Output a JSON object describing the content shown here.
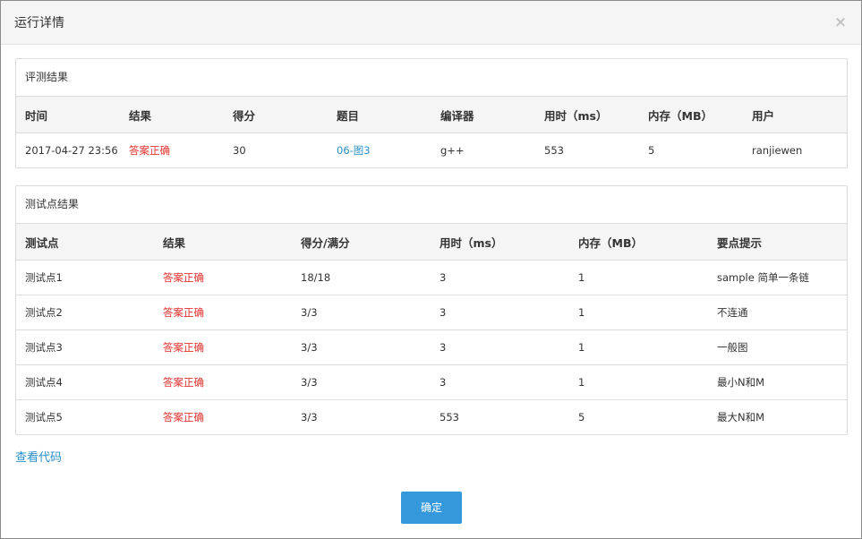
{
  "dialog": {
    "title": "运行详情",
    "close_glyph": "×"
  },
  "judge": {
    "heading": "评测结果",
    "columns": [
      "时间",
      "结果",
      "得分",
      "题目",
      "编译器",
      "用时（ms）",
      "内存（MB）",
      "用户"
    ],
    "row": {
      "time": "2017-04-27 23:56",
      "result": "答案正确",
      "score": "30",
      "problem": "06-图3",
      "compiler": "g++",
      "time_ms": "553",
      "memory_mb": "5",
      "user": "ranjiewen"
    }
  },
  "tests": {
    "heading": "测试点结果",
    "columns": [
      "测试点",
      "结果",
      "得分/满分",
      "用时（ms）",
      "内存（MB）",
      "要点提示"
    ],
    "rows": [
      {
        "name": "测试点1",
        "result": "答案正确",
        "score": "18/18",
        "time_ms": "3",
        "memory_mb": "1",
        "hint": "sample 简单一条链"
      },
      {
        "name": "测试点2",
        "result": "答案正确",
        "score": "3/3",
        "time_ms": "3",
        "memory_mb": "1",
        "hint": "不连通"
      },
      {
        "name": "测试点3",
        "result": "答案正确",
        "score": "3/3",
        "time_ms": "3",
        "memory_mb": "1",
        "hint": "一般图"
      },
      {
        "name": "测试点4",
        "result": "答案正确",
        "score": "3/3",
        "time_ms": "3",
        "memory_mb": "1",
        "hint": "最小N和M"
      },
      {
        "name": "测试点5",
        "result": "答案正确",
        "score": "3/3",
        "time_ms": "553",
        "memory_mb": "5",
        "hint": "最大N和M"
      }
    ]
  },
  "footer": {
    "view_code": "查看代码",
    "confirm": "确定"
  },
  "colors": {
    "accent": "#3598db",
    "link": "#2a8fc8",
    "correct": "#e3312d"
  }
}
